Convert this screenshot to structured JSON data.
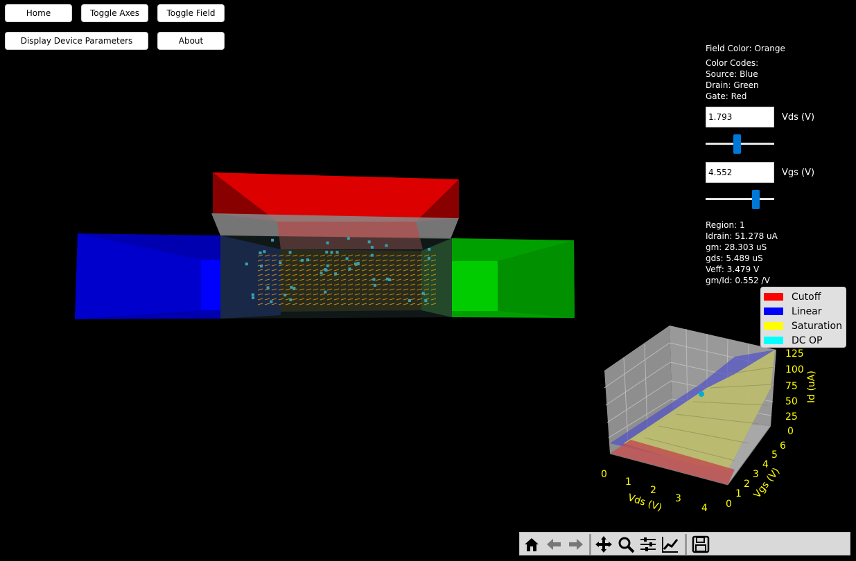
{
  "buttons": {
    "home": "Home",
    "toggle_axes": "Toggle Axes",
    "toggle_field": "Toggle Field",
    "display_params": "Display Device Parameters",
    "about": "About"
  },
  "info": {
    "field_color": "Field Color: Orange",
    "color_codes_title": "Color Codes:",
    "source": "Source: Blue",
    "drain": "Drain: Green",
    "gate": "Gate: Red"
  },
  "controls": {
    "vds_value": "1.793",
    "vds_label": "Vds (V)",
    "vds_slider_fraction": 0.45,
    "vgs_value": "4.552",
    "vgs_label": "Vgs (V)",
    "vgs_slider_fraction": 0.76
  },
  "results": {
    "region": "Region: 1",
    "idrain": "Idrain: 51.278 uA",
    "gm": "gm: 28.303 uS",
    "gds": "gds: 5.489 uS",
    "veff": "Veff: 3.479 V",
    "gm_id": "gm/Id: 0.552 /V"
  },
  "legend": [
    {
      "label": "Cutoff",
      "color": "#ff0000"
    },
    {
      "label": "Linear",
      "color": "#0000ff"
    },
    {
      "label": "Saturation",
      "color": "#ffff00"
    },
    {
      "label": "DC OP",
      "color": "#00ffff"
    }
  ],
  "plot3d": {
    "zlabel": "Id (uA)",
    "xlabel": "Vds (V)",
    "ylabel": "Vgs (V)",
    "z_ticks": [
      "125",
      "100",
      "75",
      "50",
      "25",
      "0"
    ],
    "x_ticks": [
      "0",
      "1",
      "2",
      "3",
      "4"
    ],
    "y_ticks": [
      "0",
      "1",
      "2",
      "3",
      "4",
      "5",
      "6"
    ],
    "tick_color": "#ffff00"
  },
  "toolbar": {
    "icons": [
      "home-icon",
      "back-arrow-icon",
      "forward-arrow-icon",
      "pan-icon",
      "zoom-icon",
      "configure-icon",
      "edit-curve-icon",
      "save-icon"
    ]
  },
  "colors": {
    "source": "#0000cc",
    "drain": "#00bb00",
    "gate": "#dd0000",
    "field": "#ffa500",
    "slider": "#0078d7"
  }
}
